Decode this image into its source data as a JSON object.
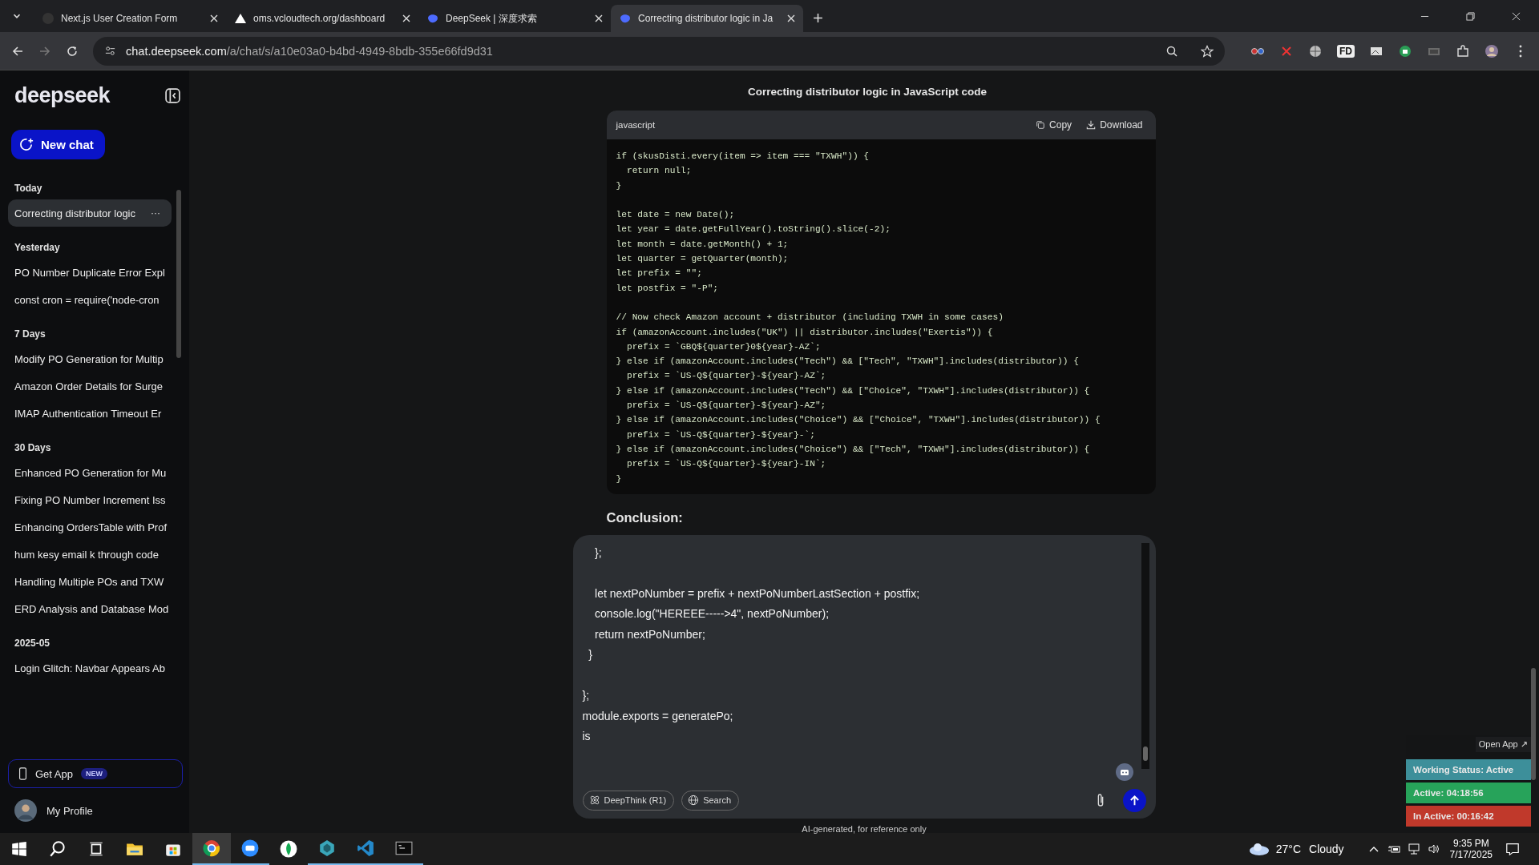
{
  "browser": {
    "tabs": [
      {
        "title": "Next.js User Creation Form",
        "selected": false
      },
      {
        "title": "oms.vcloudtech.org/dashboard",
        "selected": false
      },
      {
        "title": "DeepSeek | 深度求索",
        "selected": false
      },
      {
        "title": "Correcting distributor logic in Ja",
        "selected": true
      }
    ],
    "url_host": "chat.deepseek.com",
    "url_path": "/a/chat/s/a10e03a0-b4bd-4949-8bdb-355e66fd9d31",
    "extension_badge": "FD"
  },
  "sidebar": {
    "logo": "deepseek",
    "new_chat": "New chat",
    "sections": [
      {
        "heading": "Today",
        "items": [
          {
            "title": "Correcting distributor logic",
            "selected": true,
            "menu": "···"
          }
        ]
      },
      {
        "heading": "Yesterday",
        "items": [
          {
            "title": "PO Number Duplicate Error Expl",
            "selected": false
          },
          {
            "title": "const cron = require('node-cron",
            "selected": false
          }
        ]
      },
      {
        "heading": "7 Days",
        "items": [
          {
            "title": "Modify PO Generation for Multip",
            "selected": false
          },
          {
            "title": "Amazon Order Details for Surge",
            "selected": false
          },
          {
            "title": "IMAP Authentication Timeout Er",
            "selected": false
          }
        ]
      },
      {
        "heading": "30 Days",
        "items": [
          {
            "title": "Enhanced PO Generation for Mu",
            "selected": false
          },
          {
            "title": "Fixing PO Number Increment Iss",
            "selected": false
          },
          {
            "title": "Enhancing OrdersTable with Prof",
            "selected": false
          },
          {
            "title": "hum kesy email k through code",
            "selected": false
          },
          {
            "title": "Handling Multiple POs and TXW",
            "selected": false
          },
          {
            "title": "ERD Analysis and Database Mod",
            "selected": false
          }
        ]
      },
      {
        "heading": "2025-05",
        "items": [
          {
            "title": "Login Glitch: Navbar Appears Ab",
            "selected": false
          }
        ]
      }
    ],
    "get_app": "Get App",
    "get_app_badge": "NEW",
    "profile": "My Profile"
  },
  "chat": {
    "title": "Correcting distributor logic in JavaScript code",
    "code": {
      "language": "javascript",
      "copy": "Copy",
      "download": "Download",
      "blocks": [
        [
          "if (skusDisti.every(item => item === \"TXWH\")) {",
          "  return null;",
          "}"
        ],
        [
          "let date = new Date();",
          "let year = date.getFullYear().toString().slice(-2);",
          "let month = date.getMonth() + 1;",
          "let quarter = getQuarter(month);",
          "let prefix = \"\";",
          "let postfix = \"-P\";"
        ],
        [
          "// Now check Amazon account + distributor (including TXWH in some cases)",
          "if (amazonAccount.includes(\"UK\") || distributor.includes(\"Exertis\")) {",
          "  prefix = `GBQ${quarter}0${year}-AZ`;",
          "} else if (amazonAccount.includes(\"Tech\") && [\"Tech\", \"TXWH\"].includes(distributor)) {",
          "  prefix = `US-Q${quarter}-${year}-AZ`;",
          "} else if (amazonAccount.includes(\"Tech\") && [\"Choice\", \"TXWH\"].includes(distributor)) {",
          "  prefix = `US-Q${quarter}-${year}-AZ\";",
          "} else if (amazonAccount.includes(\"Choice\") && [\"Choice\", \"TXWH\"].includes(distributor)) {",
          "  prefix = `US-Q${quarter}-${year}-`;",
          "} else if (amazonAccount.includes(\"Choice\") && [\"Tech\", \"TXWH\"].includes(distributor)) {",
          "  prefix = `US-Q${quarter}-${year}-IN`;",
          "}"
        ]
      ]
    },
    "heading": "Conclusion:",
    "input_blocks": [
      [
        "    };"
      ],
      [
        "    let nextPoNumber = prefix + nextPoNumberLastSection + postfix;",
        "    console.log(\"HEREEE----->4\", nextPoNumber);",
        "    return nextPoNumber;",
        "  }"
      ],
      [
        "};",
        "module.exports = generatePo;",
        "is"
      ]
    ],
    "deepthink": "DeepThink (R1)",
    "deepthink_on": false,
    "search": "Search",
    "search_on": false,
    "footer": "AI-generated, for reference only"
  },
  "tracker": {
    "open_app": "Open App ↗",
    "rows": [
      {
        "text": "Working Status: Active",
        "color": "#3d8f9a"
      },
      {
        "text": "Active: 04:18:56",
        "color": "#27a35a"
      },
      {
        "text": "In Active: 00:16:42",
        "color": "#c0392b"
      }
    ]
  },
  "taskbar": {
    "temperature": "27°C",
    "weather": "Cloudy",
    "time": "9:35 PM",
    "date": "7/17/2025",
    "apps": [
      {
        "running": false,
        "selected": false
      },
      {
        "running": false,
        "selected": false
      },
      {
        "running": false,
        "selected": false
      },
      {
        "running": false,
        "selected": false
      },
      {
        "running": false,
        "selected": false
      },
      {
        "running": true,
        "selected": true
      },
      {
        "running": true,
        "selected": false
      },
      {
        "running": false,
        "selected": false
      },
      {
        "running": true,
        "selected": false
      },
      {
        "running": true,
        "selected": false
      },
      {
        "running": true,
        "selected": false
      }
    ]
  }
}
